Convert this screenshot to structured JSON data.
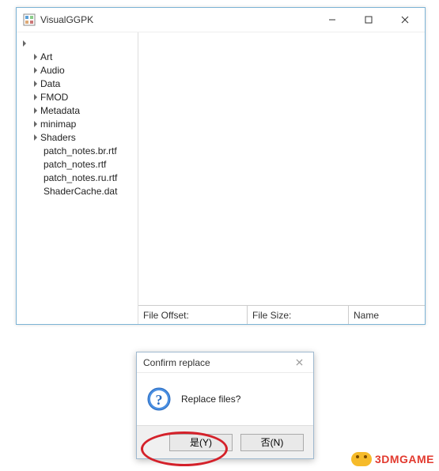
{
  "window": {
    "title": "VisualGGPK"
  },
  "tree": {
    "root_label": "",
    "folders": [
      {
        "label": "Art"
      },
      {
        "label": "Audio"
      },
      {
        "label": "Data"
      },
      {
        "label": "FMOD"
      },
      {
        "label": "Metadata"
      },
      {
        "label": "minimap"
      },
      {
        "label": "Shaders"
      }
    ],
    "files": [
      {
        "label": "patch_notes.br.rtf"
      },
      {
        "label": "patch_notes.rtf"
      },
      {
        "label": "patch_notes.ru.rtf"
      },
      {
        "label": "ShaderCache.dat"
      }
    ]
  },
  "status": {
    "offset_label": "File Offset:",
    "offset_value": "",
    "size_label": "File Size:",
    "size_value": "",
    "name_label": "Name",
    "name_value": ""
  },
  "dialog": {
    "title": "Confirm replace",
    "message": "Replace files?",
    "yes_label": "是(Y)",
    "no_label": "否(N)"
  },
  "watermark": {
    "text": "3DMGAME"
  }
}
